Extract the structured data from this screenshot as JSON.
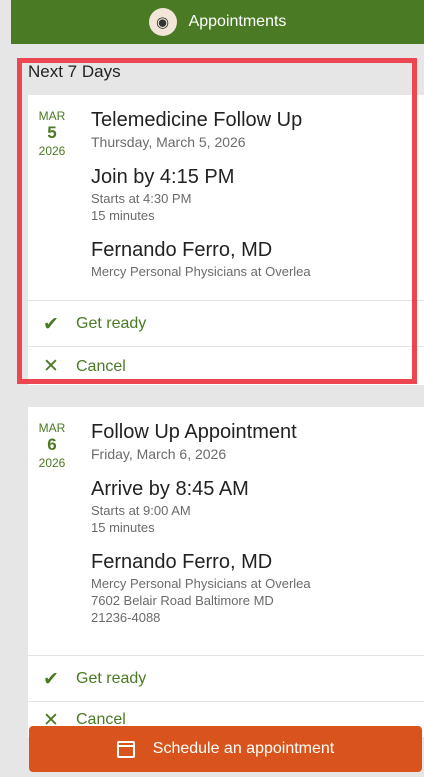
{
  "header": {
    "title": "Appointments",
    "logo_icon": "app-logo-icon"
  },
  "section": {
    "label": "Next 7 Days"
  },
  "appointments": [
    {
      "month": "MAR",
      "day": "5",
      "year": "2026",
      "title": "Telemedicine Follow Up",
      "date_text": "Thursday, March 5, 2026",
      "time_main": "Join by 4:15 PM",
      "starts": "Starts at 4:30 PM",
      "duration": "15 minutes",
      "provider": "Fernando Ferro, MD",
      "location": "Mercy Personal Physicians at Overlea",
      "actions": {
        "get_ready": "Get ready",
        "cancel": "Cancel"
      }
    },
    {
      "month": "MAR",
      "day": "6",
      "year": "2026",
      "title": "Follow Up Appointment",
      "date_text": "Friday, March 6, 2026",
      "time_main": "Arrive by 8:45 AM",
      "starts": "Starts at 9:00 AM",
      "duration": "15 minutes",
      "provider": "Fernando Ferro, MD",
      "location": "Mercy Personal Physicians at Overlea",
      "address_line1": "7602 Belair Road Baltimore MD",
      "address_line2": "21236-4088",
      "actions": {
        "get_ready": "Get ready",
        "cancel": "Cancel"
      }
    }
  ],
  "fab": {
    "label": "Schedule an appointment",
    "icon": "calendar-icon"
  },
  "colors": {
    "header": "#4a7a23",
    "accent": "#4a7a23",
    "fab": "#d9541c",
    "highlight": "#ec4650"
  }
}
